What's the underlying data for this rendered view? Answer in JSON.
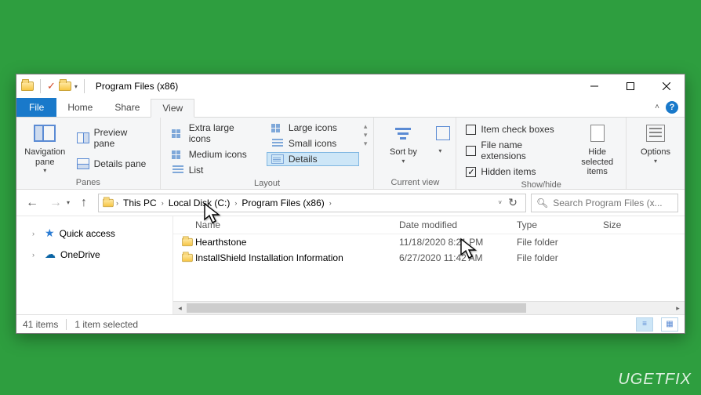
{
  "title": "Program Files (x86)",
  "menu": {
    "file": "File",
    "home": "Home",
    "share": "Share",
    "view": "View"
  },
  "ribbon": {
    "panes": {
      "navigation": "Navigation pane",
      "preview": "Preview pane",
      "details": "Details pane",
      "group": "Panes"
    },
    "layout": {
      "extra_large": "Extra large icons",
      "large": "Large icons",
      "medium": "Medium icons",
      "small": "Small icons",
      "list": "List",
      "details": "Details",
      "group": "Layout"
    },
    "current_view": {
      "sort": "Sort by",
      "group": "Current view"
    },
    "show_hide": {
      "item_check": "Item check boxes",
      "file_ext": "File name extensions",
      "hidden": "Hidden items",
      "hide_selected": "Hide selected items",
      "group": "Show/hide"
    },
    "options": "Options"
  },
  "breadcrumb": {
    "seg1": "This PC",
    "seg2": "Local Disk (C:)",
    "seg3": "Program Files (x86)"
  },
  "search_placeholder": "Search Program Files (x...",
  "sidebar": {
    "quick": "Quick access",
    "onedrive": "OneDrive"
  },
  "columns": {
    "name": "Name",
    "modified": "Date modified",
    "type": "Type",
    "size": "Size"
  },
  "rows": [
    {
      "name": "Hearthstone",
      "modified": "11/18/2020 8:21 PM",
      "type": "File folder"
    },
    {
      "name": "InstallShield Installation Information",
      "modified": "6/27/2020 11:42 AM",
      "type": "File folder"
    }
  ],
  "status": {
    "count": "41 items",
    "selected": "1 item selected"
  },
  "watermark": "UGETFIX"
}
